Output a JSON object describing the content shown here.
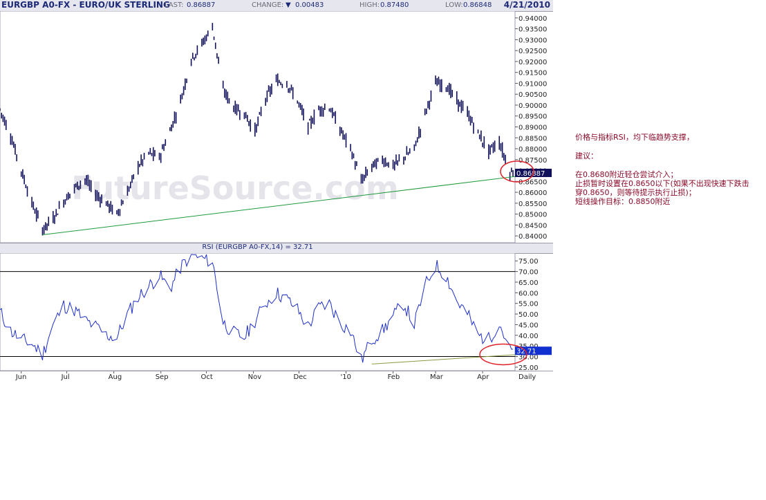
{
  "header": {
    "title": "EURGBP A0-FX - EURO/UK STERLING",
    "last_label": "LAST:",
    "last_value": "0.86887",
    "change_label": "CHANGE:",
    "change_value": "0.00483",
    "high_label": "HIGH:",
    "high_value": "0.87480",
    "low_label": "LOW:",
    "low_value": "0.86848",
    "date": "4/21/2010"
  },
  "watermark": "FutureSource.com",
  "colors": {
    "header_bg": "#e6e6ee",
    "bars": "#10105a",
    "trendline": "#1f9a3a",
    "rsi_line": "#1f2fc8",
    "rsi_trend": "#8a9a40",
    "circle": "#e0202a",
    "label_bg": "#1030d0",
    "annotation_text": "#8b0a2a"
  },
  "chart_data": [
    {
      "type": "ohlc",
      "ylim": [
        0.8375,
        0.9425
      ],
      "yticks": [
        "0.94000",
        "0.93500",
        "0.93000",
        "0.92500",
        "0.92000",
        "0.91500",
        "0.91000",
        "0.90500",
        "0.90000",
        "0.89500",
        "0.89000",
        "0.88500",
        "0.88000",
        "0.87500",
        "0.87000",
        "0.86500",
        "0.86000",
        "0.85500",
        "0.85000",
        "0.84500",
        "0.84000"
      ],
      "last_value_label": "0.86887",
      "series": [
        {
          "name": "close",
          "x": [
            "2009-05-18",
            "2009-05-25",
            "2009-06-01",
            "2009-06-08",
            "2009-06-15",
            "2009-06-22",
            "2009-06-29",
            "2009-07-06",
            "2009-07-13",
            "2009-07-20",
            "2009-07-27",
            "2009-08-03",
            "2009-08-10",
            "2009-08-17",
            "2009-08-24",
            "2009-08-31",
            "2009-09-07",
            "2009-09-14",
            "2009-09-21",
            "2009-09-28",
            "2009-10-05",
            "2009-10-12",
            "2009-10-19",
            "2009-10-26",
            "2009-11-02",
            "2009-11-09",
            "2009-11-16",
            "2009-11-23",
            "2009-11-30",
            "2009-12-07",
            "2009-12-14",
            "2009-12-21",
            "2009-12-28",
            "2010-01-04",
            "2010-01-11",
            "2010-01-18",
            "2010-01-25",
            "2010-02-01",
            "2010-02-08",
            "2010-02-15",
            "2010-02-22",
            "2010-03-01",
            "2010-03-08",
            "2010-03-15",
            "2010-03-22",
            "2010-03-29",
            "2010-04-05",
            "2010-04-12",
            "2010-04-19"
          ],
          "values": [
            0.898,
            0.886,
            0.87,
            0.855,
            0.843,
            0.848,
            0.856,
            0.862,
            0.866,
            0.859,
            0.855,
            0.85,
            0.86,
            0.872,
            0.878,
            0.876,
            0.888,
            0.902,
            0.921,
            0.928,
            0.936,
            0.907,
            0.899,
            0.896,
            0.888,
            0.903,
            0.911,
            0.91,
            0.902,
            0.89,
            0.898,
            0.899,
            0.889,
            0.88,
            0.865,
            0.872,
            0.875,
            0.872,
            0.876,
            0.88,
            0.896,
            0.91,
            0.909,
            0.902,
            0.896,
            0.887,
            0.879,
            0.883,
            0.869
          ]
        }
      ],
      "trendline": {
        "from": [
          "2009-06-15",
          0.8405
        ],
        "to": [
          "2010-04-19",
          0.8675
        ]
      }
    },
    {
      "type": "line",
      "title": "RSI (EURGBP A0-FX,14) = 32.71",
      "ylim": [
        24,
        78
      ],
      "yticks": [
        "75.00",
        "70.00",
        "65.00",
        "60.00",
        "55.00",
        "50.00",
        "45.00",
        "40.00",
        "35.00",
        "30.00",
        "25.00"
      ],
      "hlines": [
        70,
        30
      ],
      "last_value_label": "32.71",
      "series": [
        {
          "name": "RSI",
          "x": [
            "2009-05-18",
            "2009-05-25",
            "2009-06-01",
            "2009-06-08",
            "2009-06-15",
            "2009-06-22",
            "2009-06-29",
            "2009-07-06",
            "2009-07-13",
            "2009-07-20",
            "2009-07-27",
            "2009-08-03",
            "2009-08-10",
            "2009-08-17",
            "2009-08-24",
            "2009-08-31",
            "2009-09-07",
            "2009-09-14",
            "2009-09-21",
            "2009-09-28",
            "2009-10-05",
            "2009-10-12",
            "2009-10-19",
            "2009-10-26",
            "2009-11-02",
            "2009-11-09",
            "2009-11-16",
            "2009-11-23",
            "2009-11-30",
            "2009-12-07",
            "2009-12-14",
            "2009-12-21",
            "2009-12-28",
            "2010-01-04",
            "2010-01-11",
            "2010-01-18",
            "2010-01-25",
            "2010-02-01",
            "2010-02-08",
            "2010-02-15",
            "2010-02-22",
            "2010-03-01",
            "2010-03-08",
            "2010-03-15",
            "2010-03-22",
            "2010-03-29",
            "2010-04-05",
            "2010-04-12",
            "2010-04-19"
          ],
          "values": [
            51,
            42,
            38,
            36,
            31,
            45,
            54,
            52,
            47,
            44,
            40,
            39,
            50,
            58,
            63,
            68,
            62,
            72,
            78,
            76,
            75,
            46,
            41,
            39,
            47,
            55,
            60,
            57,
            52,
            44,
            53,
            55,
            46,
            42,
            28,
            38,
            42,
            49,
            55,
            45,
            63,
            73,
            68,
            56,
            50,
            40,
            38,
            46,
            32.71
          ]
        }
      ],
      "trendline": {
        "from": [
          "2010-01-18",
          26.5
        ],
        "to": [
          "2010-04-19",
          31
        ]
      }
    }
  ],
  "x_axis": {
    "ticks": [
      {
        "label": "Jun",
        "date": "2009-06-01"
      },
      {
        "label": "Jul",
        "date": "2009-07-01"
      },
      {
        "label": "Aug",
        "date": "2009-08-01"
      },
      {
        "label": "Sep",
        "date": "2009-09-01"
      },
      {
        "label": "Oct",
        "date": "2009-10-01"
      },
      {
        "label": "Nov",
        "date": "2009-11-01"
      },
      {
        "label": "Dec",
        "date": "2009-12-01"
      },
      {
        "label": "'10",
        "date": "2010-01-01"
      },
      {
        "label": "Feb",
        "date": "2010-02-01"
      },
      {
        "label": "Mar",
        "date": "2010-03-01"
      },
      {
        "label": "Apr",
        "date": "2010-04-01"
      }
    ],
    "period_label": "Daily"
  },
  "annotation": {
    "line1": "价格与指标RSI，均下临趋势支撑，",
    "line2": "建议：",
    "line3": "在0.8680附近轻仓尝试介入；",
    "line4": "止损暂时设置在0.8650以下(如果不出现快速下跌击穿0.8650，则等待提示执行止损)；",
    "line5": "短线操作目标：0.8850附近"
  }
}
